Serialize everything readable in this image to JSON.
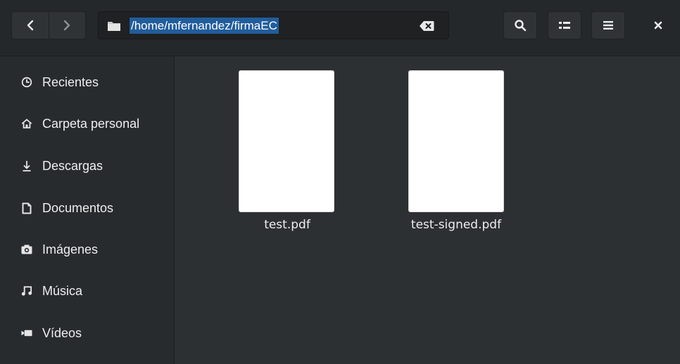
{
  "header": {
    "path": "/home/mfernandez/firmaEC",
    "icons": {
      "back": "chevron-left-icon",
      "forward": "chevron-right-icon",
      "folder": "folder-icon",
      "clear": "backspace-icon",
      "search": "search-icon",
      "view": "grid-view-icon",
      "menu": "hamburger-menu-icon",
      "close": "close-icon"
    }
  },
  "sidebar": {
    "items": [
      {
        "label": "Recientes",
        "icon": "clock-icon"
      },
      {
        "label": "Carpeta personal",
        "icon": "home-icon"
      },
      {
        "label": "Descargas",
        "icon": "download-icon"
      },
      {
        "label": "Documentos",
        "icon": "document-icon"
      },
      {
        "label": "Imágenes",
        "icon": "camera-icon"
      },
      {
        "label": "Música",
        "icon": "music-icon"
      },
      {
        "label": "Vídeos",
        "icon": "video-icon"
      }
    ]
  },
  "files": [
    {
      "name": "test.pdf"
    },
    {
      "name": "test-signed.pdf"
    }
  ],
  "colors": {
    "background": "#2d3033",
    "header": "#25282b",
    "sidebar": "#282b2e",
    "selection": "#215d9c"
  }
}
